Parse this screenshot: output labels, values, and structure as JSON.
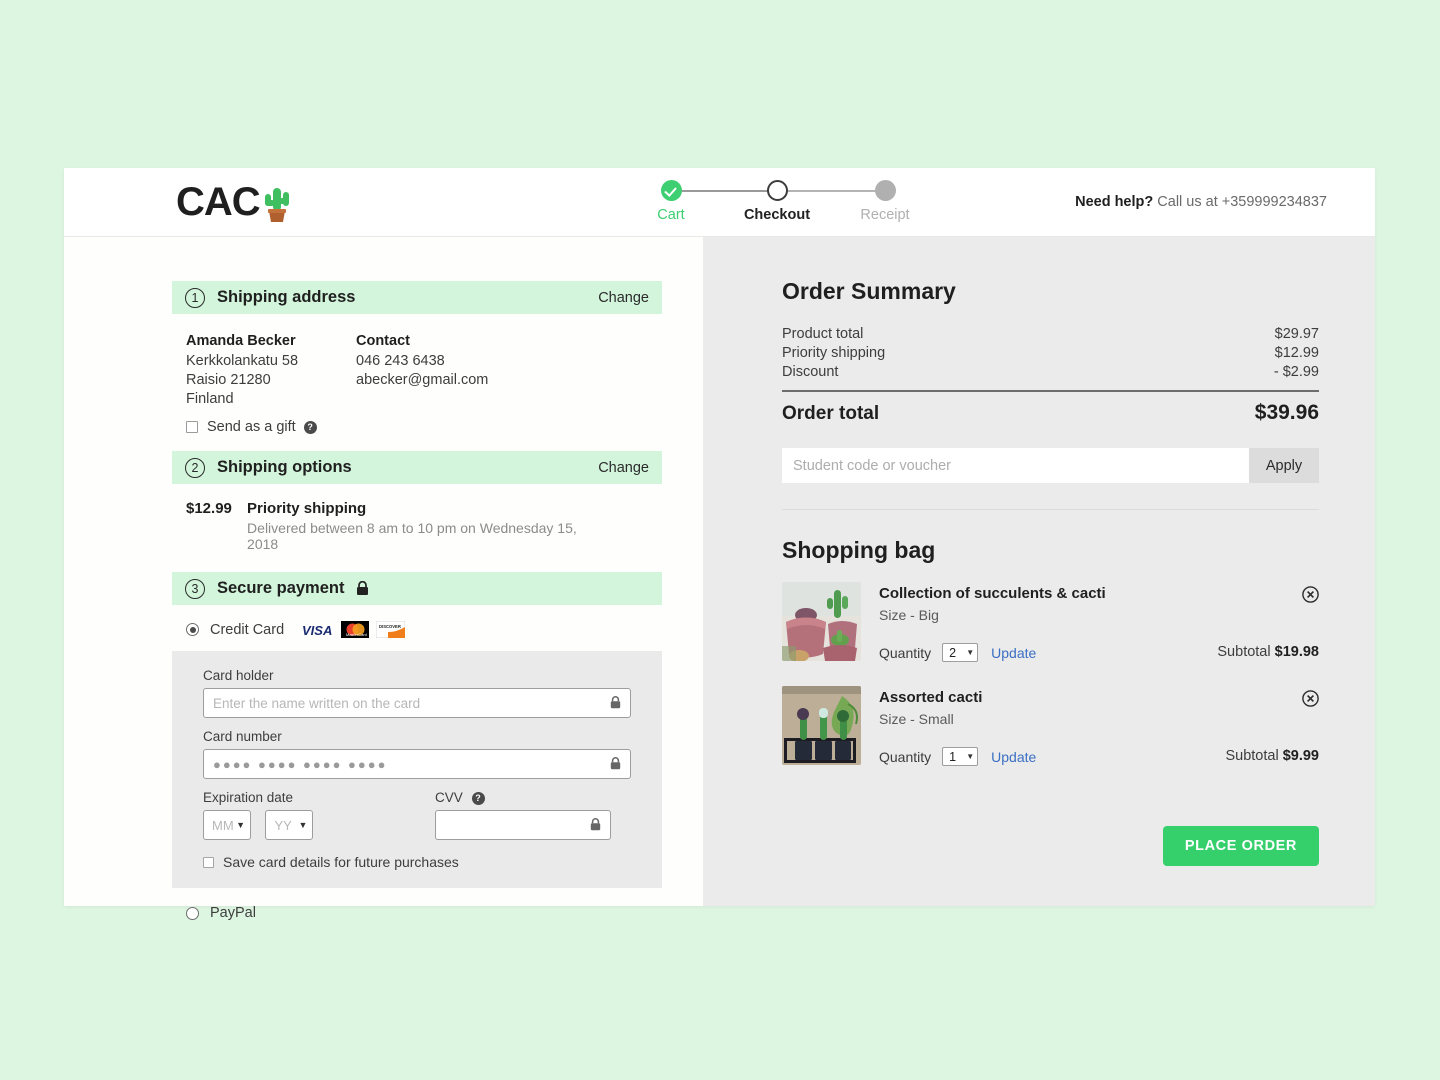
{
  "header": {
    "logo_text": "CAC",
    "logo_icon": "cactus-icon",
    "help_strong": "Need help?",
    "help_rest": "Call us at +359999234837",
    "steps": [
      {
        "label": "Cart",
        "state": "done"
      },
      {
        "label": "Checkout",
        "state": "current"
      },
      {
        "label": "Receipt",
        "state": "todo"
      }
    ]
  },
  "shipping_address": {
    "number": "1",
    "title": "Shipping address",
    "change_label": "Change",
    "name": "Amanda Becker",
    "street": "Kerkkolankatu 58",
    "city": "Raisio 21280",
    "country": "Finland",
    "contact_title": "Contact",
    "phone": "046 243 6438",
    "email": "abecker@gmail.com",
    "gift_label": "Send as a gift",
    "gift_checked": false,
    "help_icon": "question-mark-icon"
  },
  "shipping_options": {
    "number": "2",
    "title": "Shipping options",
    "change_label": "Change",
    "price": "$12.99",
    "name": "Priority shipping",
    "description": "Delivered between 8 am to 10 pm on Wednesday 15, 2018"
  },
  "secure_payment": {
    "number": "3",
    "title": "Secure payment",
    "lock_icon": "lock-icon",
    "credit_card_label": "Credit Card",
    "credit_card_selected": true,
    "brands": [
      "visa",
      "mastercard",
      "discover"
    ],
    "card_holder_label": "Card holder",
    "card_holder_placeholder": "Enter the name written on the card",
    "card_holder_value": "",
    "card_number_label": "Card number",
    "card_number_value": "●●●●  ●●●●  ●●●●  ●●●●",
    "expiration_label": "Expiration date",
    "month_value": "MM",
    "year_value": "YY",
    "cvv_label": "CVV",
    "cvv_help_icon": "question-mark-icon",
    "cvv_value": "",
    "save_label": "Save card details for future purchases",
    "save_checked": false,
    "paypal_label": "PayPal",
    "paypal_selected": false
  },
  "order_summary": {
    "title": "Order Summary",
    "rows": [
      {
        "label": "Product total",
        "value": "$29.97"
      },
      {
        "label": "Priority shipping",
        "value": "$12.99"
      },
      {
        "label": "Discount",
        "value": "- $2.99"
      }
    ],
    "total_label": "Order total",
    "total_value": "$39.96",
    "voucher_placeholder": "Student code or voucher",
    "voucher_value": "",
    "apply_label": "Apply"
  },
  "shopping_bag": {
    "title": "Shopping bag",
    "quantity_label": "Quantity",
    "update_label": "Update",
    "subtotal_label": "Subtotal",
    "remove_icon": "circle-x-icon",
    "items": [
      {
        "name": "Collection of succulents & cacti",
        "size": "Size - Big",
        "quantity": "2",
        "subtotal": "$19.98",
        "image": "pink-pots-succulents-photo"
      },
      {
        "name": "Assorted cacti",
        "size": "Size - Small",
        "quantity": "1",
        "subtotal": "$9.99",
        "image": "three-cacti-on-shelf-photo"
      }
    ],
    "place_order_label": "PLACE ORDER"
  },
  "colors": {
    "page_background": "#ddf6e1",
    "accent_green": "#35cf6c",
    "section_header_green": "#d2f5db",
    "right_panel_gray": "#ebebeb",
    "card_box_gray": "#eaeaea",
    "link_blue": "#3a6fc4"
  }
}
